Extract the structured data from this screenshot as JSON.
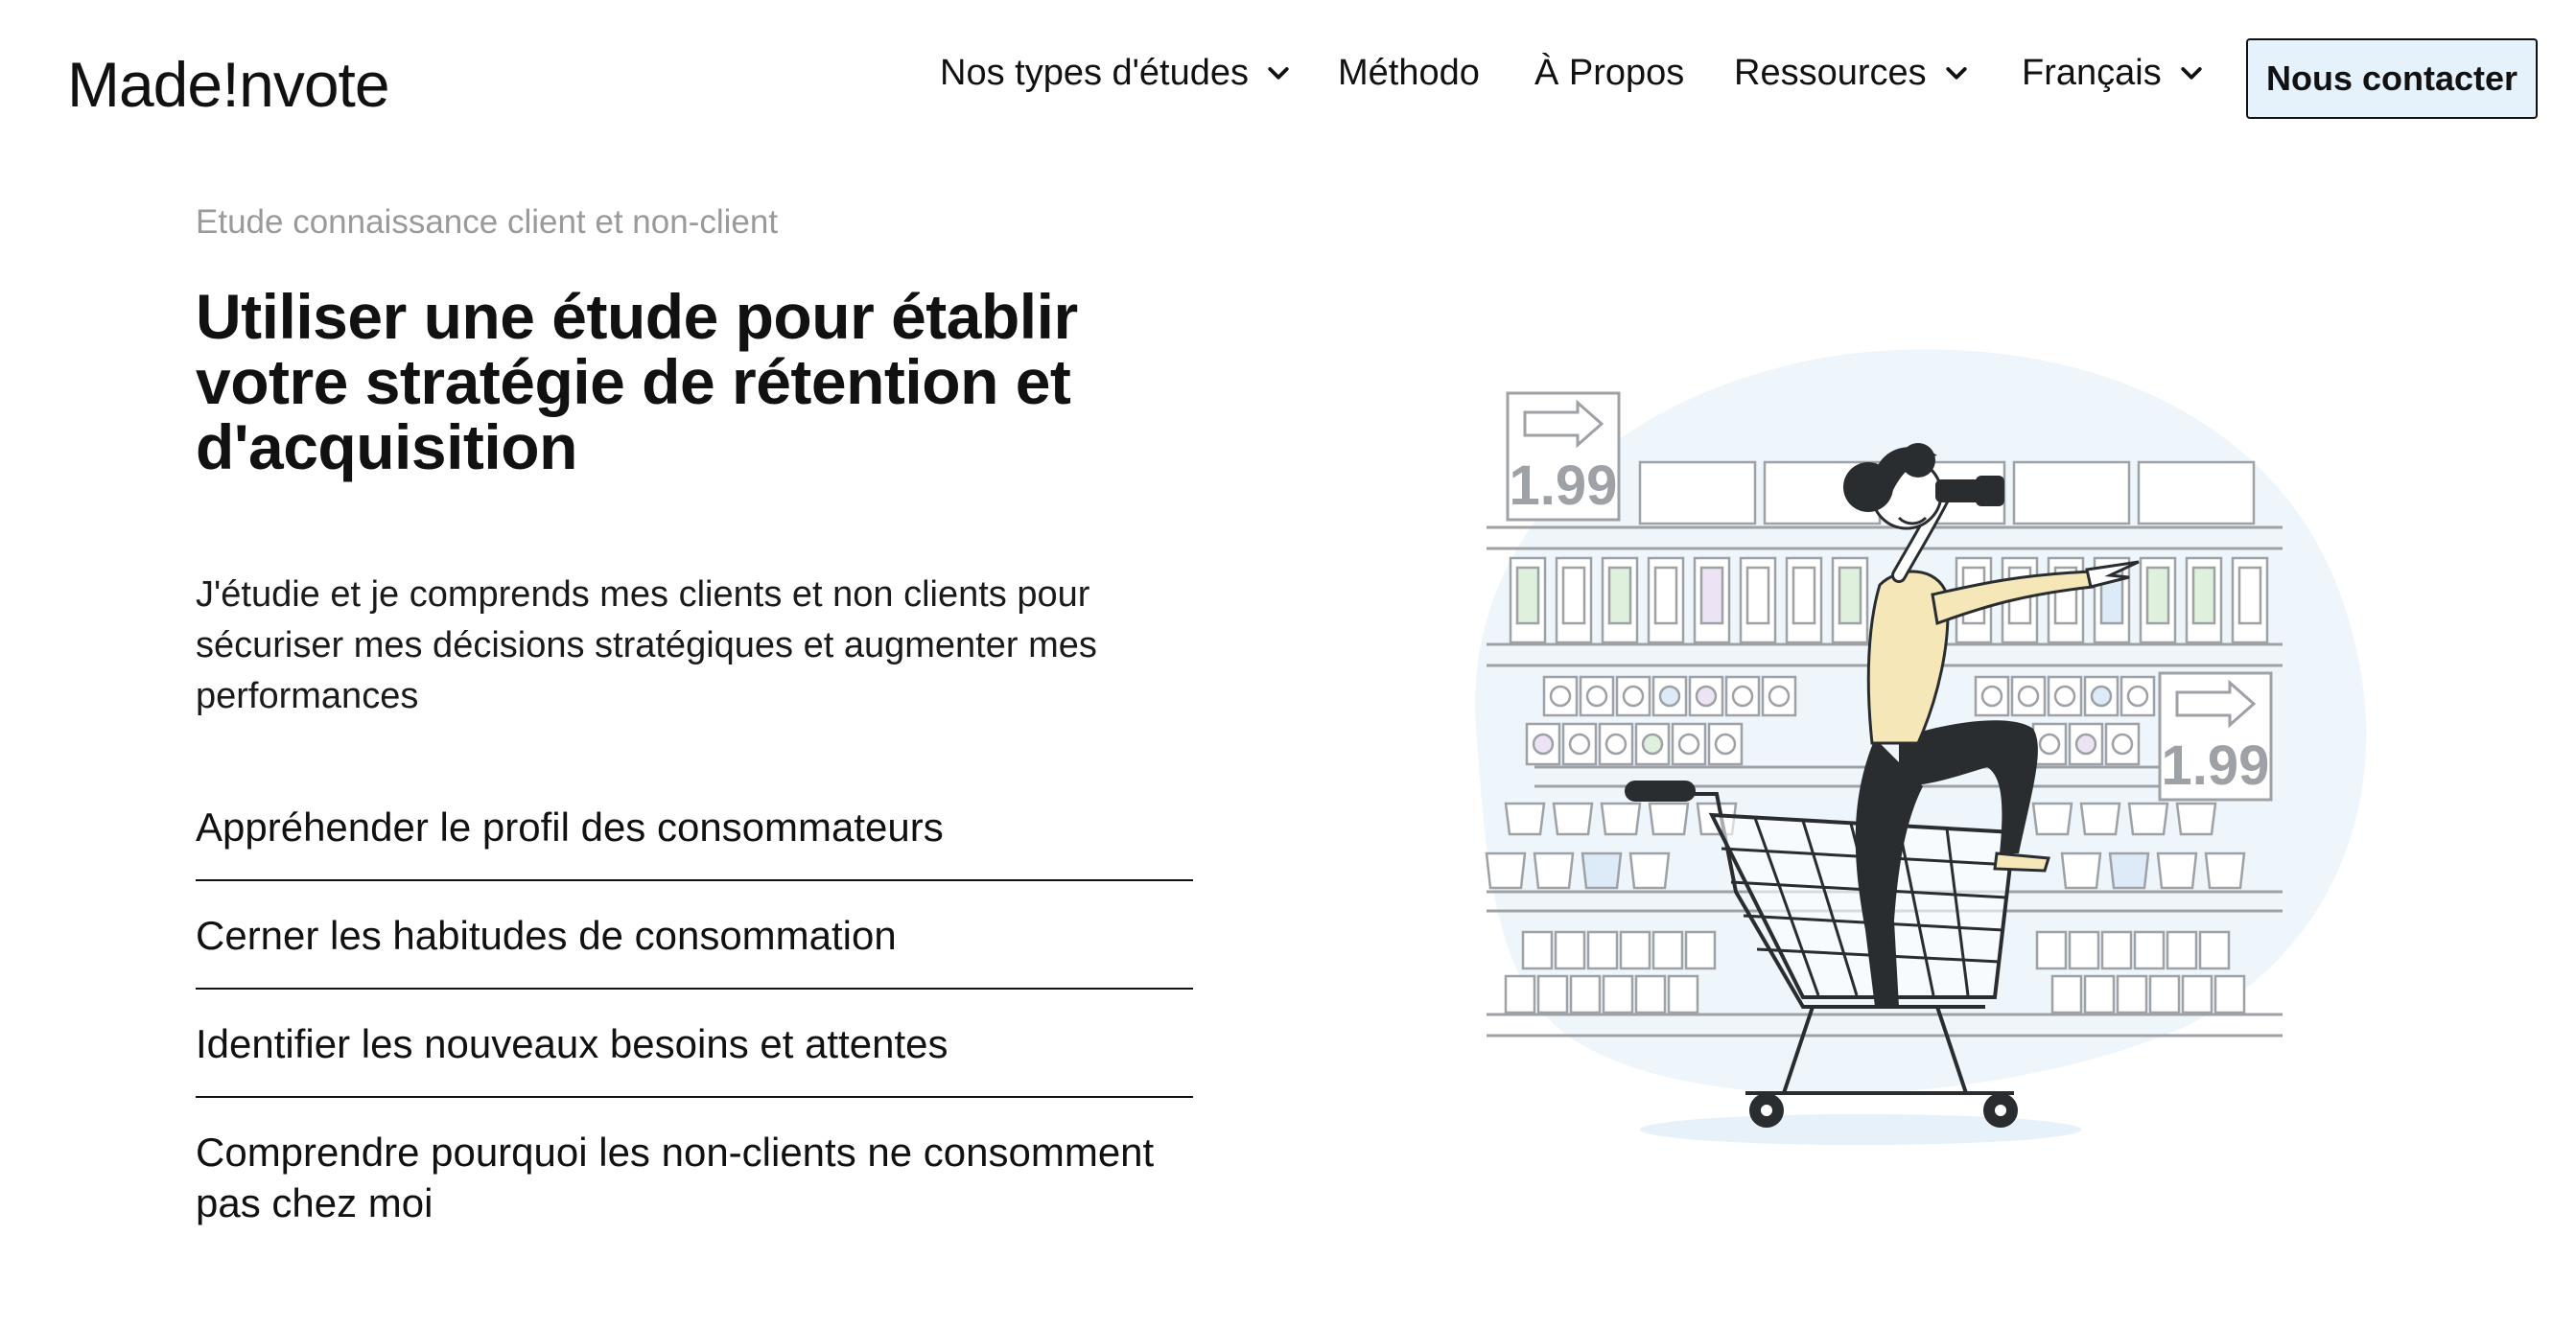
{
  "header": {
    "logo": {
      "part1": "Made",
      "part2": "nvote",
      "mark": "!"
    },
    "nav": [
      {
        "label": "Nos types d'études",
        "has_dropdown": true
      },
      {
        "label": "Méthodo",
        "has_dropdown": false
      },
      {
        "label": "À Propos",
        "has_dropdown": false
      },
      {
        "label": "Ressources",
        "has_dropdown": true
      },
      {
        "label": "Français",
        "has_dropdown": true
      }
    ],
    "cta_label": "Nous contacter"
  },
  "hero": {
    "eyebrow": "Etude connaissance client et non-client",
    "title": "Utiliser une étude pour établir votre stratégie de rétention et d'acquisition",
    "intro": "J'étudie et je comprends mes clients et non clients pour sécuriser mes décisions stratégiques et augmenter mes performances",
    "points": [
      "Appréhender le profil des consommateurs",
      "Cerner les habitudes de consommation",
      "Identifier les nouveaux besoins et attentes",
      "Comprendre pourquoi les non-clients ne consomment pas chez moi"
    ]
  },
  "illustration": {
    "price_left": "1.99",
    "price_right": "1.99"
  },
  "colors": {
    "cta_background": "#e5f2fc",
    "blob": "#eef6fc",
    "text": "#111111",
    "eyebrow": "#9a9a9a",
    "shirt": "#f5e7b8",
    "pants": "#2a2d30"
  }
}
